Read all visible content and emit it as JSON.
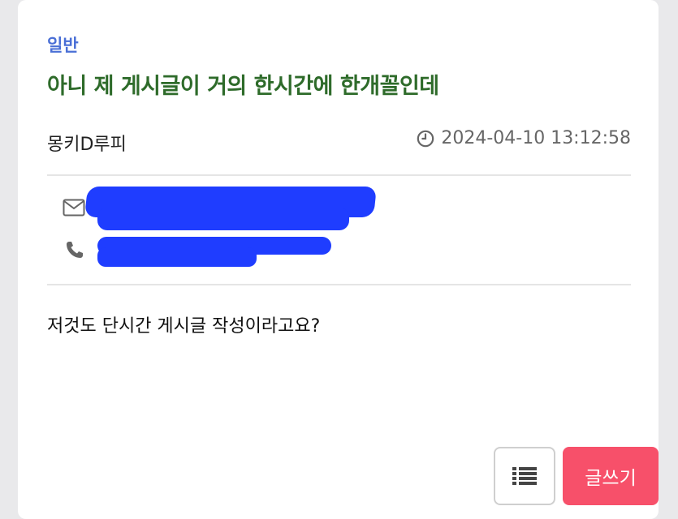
{
  "post": {
    "category": "일반",
    "title": "아니 제 게시글이 거의 한시간에 한개꼴인데",
    "author": "몽키D루피",
    "date": "2024-04-10 13:12:58",
    "body": "저것도 단시간 게시글 작성이라고요?"
  },
  "contact": {
    "email_icon": "mail-icon",
    "phone_icon": "phone-icon"
  },
  "actions": {
    "list_icon": "list-icon",
    "write_label": "글쓰기"
  },
  "colors": {
    "category": "#4a6fd6",
    "title": "#2e6b2a",
    "write_button": "#f7506a",
    "redaction": "#1f3dff"
  }
}
